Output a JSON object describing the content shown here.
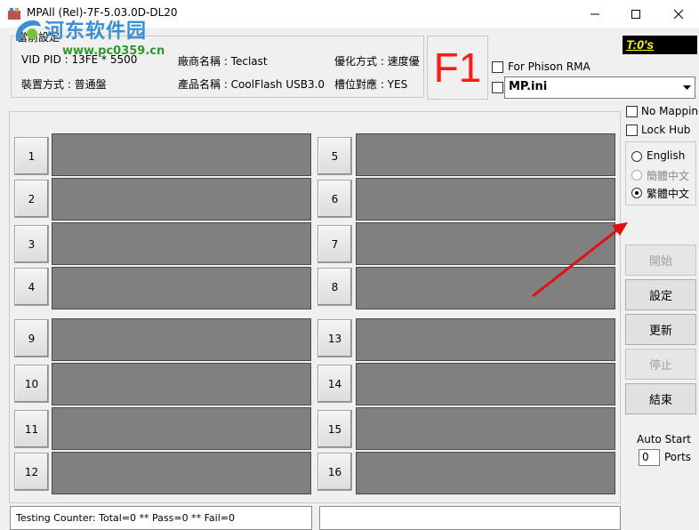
{
  "window": {
    "title": "MPAll (Rel)-7F-5.03.0D-DL20",
    "watermark_text": "河东软件园",
    "watermark_url": "www.pc0359.cn"
  },
  "device_group": {
    "label": "當前設定",
    "vid_pid": "VID PID : 13FE * 5500",
    "vendor_name": "廠商名稱 : Teclast",
    "optimize_mode": "優化方式 : 速度優",
    "device_mode": "裝置方式 : 普通盤",
    "product_name": "產品名稱 : CoolFlash USB3.0",
    "slot_mapping": "槽位對應 : YES"
  },
  "f1_label": "F1",
  "timer": "T:0's",
  "options": {
    "for_phison_rma": "For Phison RMA",
    "ini_file": "MP.ini",
    "no_mapping": "No Mapping",
    "lock_hub": "Lock Hub"
  },
  "language": {
    "english": "English",
    "simplified": "簡體中文",
    "traditional": "繁體中文",
    "selected": "traditional"
  },
  "ports_left": [
    "1",
    "2",
    "3",
    "4",
    "9",
    "10",
    "11",
    "12"
  ],
  "ports_right": [
    "5",
    "6",
    "7",
    "8",
    "13",
    "14",
    "15",
    "16"
  ],
  "actions": {
    "start": "開始",
    "settings": "設定",
    "update": "更新",
    "stop": "停止",
    "exit": "結束"
  },
  "auto_start": {
    "label": "Auto Start",
    "value": "0",
    "unit": "Ports"
  },
  "status": {
    "counter": "Testing Counter: Total=0 ** Pass=0 ** Fail=0",
    "right": ""
  },
  "colors": {
    "f1": "#ff1a1a",
    "timer_bg": "#000000",
    "timer_text": "#ffff00",
    "port_panel": "#808080",
    "arrow": "#e01010"
  }
}
